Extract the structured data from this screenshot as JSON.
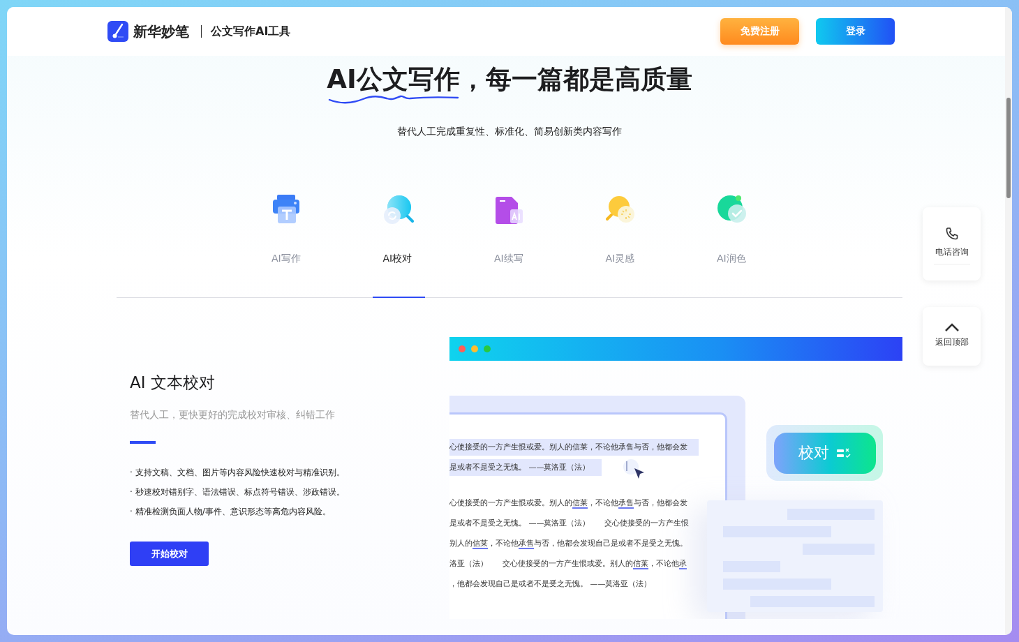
{
  "header": {
    "brand": "新华妙笔",
    "tagline": "公文写作AI工具",
    "buttons": [
      {
        "label": "免费注册",
        "kind": "register"
      },
      {
        "label": "登录",
        "kind": "login"
      }
    ]
  },
  "hero": {
    "title": "AI公文写作，每一篇都是高质量",
    "subtitle": "替代人工完成重复性、标准化、简易创新类内容写作"
  },
  "tabs": [
    {
      "label": "AI写作",
      "kind": "printer",
      "selected": false
    },
    {
      "label": "AI校对",
      "kind": "magnifier",
      "selected": true
    },
    {
      "label": "AI续写",
      "kind": "document",
      "selected": false
    },
    {
      "label": "AI灵感",
      "kind": "bulb",
      "selected": false
    },
    {
      "label": "AI润色",
      "kind": "check",
      "selected": false
    }
  ],
  "feature": {
    "title": "AI 文本校对",
    "description": "替代人工，更快更好的完成校对审核、纠错工作",
    "points": [
      "· 支持文稿、文档、图片等内容风险快速校对与精准识别。",
      "· 秒速校对错别字、语法错误、标点符号错误、涉政错误。",
      "· 精准检测负面人物/事件、意识形态等高危内容风险。"
    ],
    "button": "开始校对"
  },
  "demo": {
    "badge": "校对",
    "lines": [
      {
        "highlighted": true,
        "segments": [
          {
            "text": "心使接受的一方产生恨或爱。别人的信莱，不论他承售与否，他都会发",
            "marked": false
          }
        ]
      },
      {
        "highlighted": true,
        "segments": [
          {
            "text": "是或者不是受之无愧。 ——莫洛亚（法）",
            "marked": false
          }
        ]
      },
      {
        "highlighted": false,
        "segments": [
          {
            "text": "心使接受的一方产生恨或爱。别人的",
            "marked": false
          },
          {
            "text": "信莱",
            "marked": true
          },
          {
            "text": "，不论他",
            "marked": false
          },
          {
            "text": "承售",
            "marked": true
          },
          {
            "text": "与否，他都会发",
            "marked": false
          }
        ]
      },
      {
        "highlighted": false,
        "segments": [
          {
            "text": "是或者不是受之无愧。 ——莫洛亚（法）      交心使接受的一方产生恨",
            "marked": false
          }
        ]
      },
      {
        "highlighted": false,
        "segments": [
          {
            "text": "别人的",
            "marked": false
          },
          {
            "text": "信莱",
            "marked": true
          },
          {
            "text": "，不论他",
            "marked": false
          },
          {
            "text": "承售",
            "marked": true
          },
          {
            "text": "与否，他都会发现自己是或者不是受之无愧。",
            "marked": false
          }
        ]
      },
      {
        "highlighted": false,
        "segments": [
          {
            "text": "洛亚（法）      交心使接受的一方产生恨或爱。别人的",
            "marked": false
          },
          {
            "text": "信莱",
            "marked": true
          },
          {
            "text": "，不论他",
            "marked": false
          },
          {
            "text": "承",
            "marked": true
          }
        ]
      },
      {
        "highlighted": false,
        "segments": [
          {
            "text": "，他都会发现自己是或者不是受之无愧。 ——莫洛亚（法）",
            "marked": false
          }
        ]
      }
    ]
  },
  "side": [
    {
      "label": "电话咨询",
      "kind": "phone"
    },
    {
      "label": "返回顶部",
      "kind": "top"
    }
  ]
}
